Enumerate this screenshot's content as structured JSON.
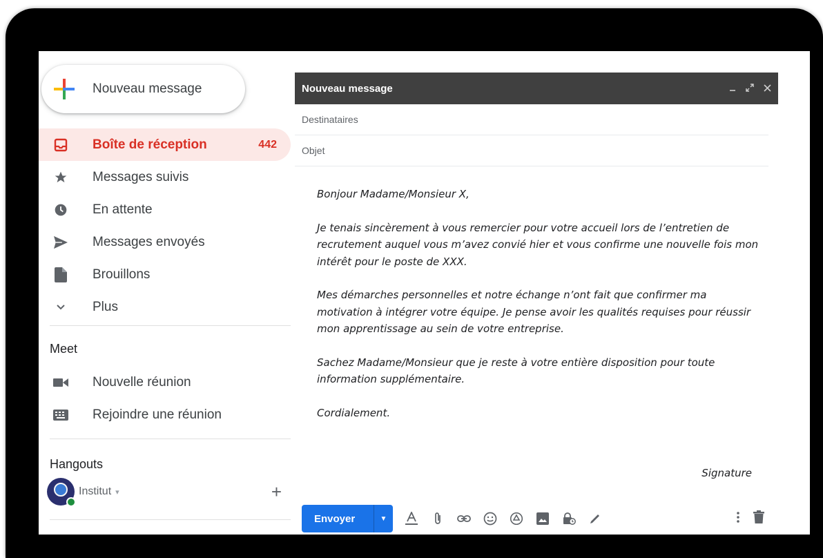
{
  "compose_button": {
    "label": "Nouveau message"
  },
  "nav": [
    {
      "label": "Boîte de réception",
      "count": "442",
      "icon": "inbox-icon"
    },
    {
      "label": "Messages suivis",
      "icon": "star-icon"
    },
    {
      "label": "En attente",
      "icon": "clock-icon"
    },
    {
      "label": "Messages envoyés",
      "icon": "send-icon"
    },
    {
      "label": "Brouillons",
      "icon": "file-icon"
    },
    {
      "label": "Plus",
      "icon": "chevron-down-icon"
    }
  ],
  "meet": {
    "title": "Meet",
    "items": [
      {
        "label": "Nouvelle réunion",
        "icon": "video-icon"
      },
      {
        "label": "Rejoindre une réunion",
        "icon": "keyboard-icon"
      }
    ]
  },
  "hangouts": {
    "title": "Hangouts",
    "user": "Institut",
    "caret": "▾",
    "add": "+"
  },
  "compose": {
    "title": "Nouveau message",
    "recipients_placeholder": "Destinataires",
    "subject_placeholder": "Objet",
    "body": [
      "Bonjour Madame/Monsieur X,",
      "Je tenais sincèrement à vous remercier pour votre accueil lors de l’entretien de recrutement auquel vous m’avez convié hier et vous confirme une nouvelle fois mon intérêt pour le poste de XXX.",
      "Mes démarches personnelles et notre échange n’ont fait que confirmer ma motivation à intégrer votre équipe. Je pense avoir les qualités requises pour réussir mon apprentissage au sein de votre entreprise.",
      "Sachez Madame/Monsieur que je reste à votre entière disposition pour toute information supplémentaire.",
      "Cordialement."
    ],
    "signature": "Signature",
    "send_label": "Envoyer"
  },
  "colors": {
    "accent": "#1a73e8",
    "inbox_active": "#d93025",
    "inbox_bg": "#fce8e6",
    "header_bg": "#404040"
  }
}
